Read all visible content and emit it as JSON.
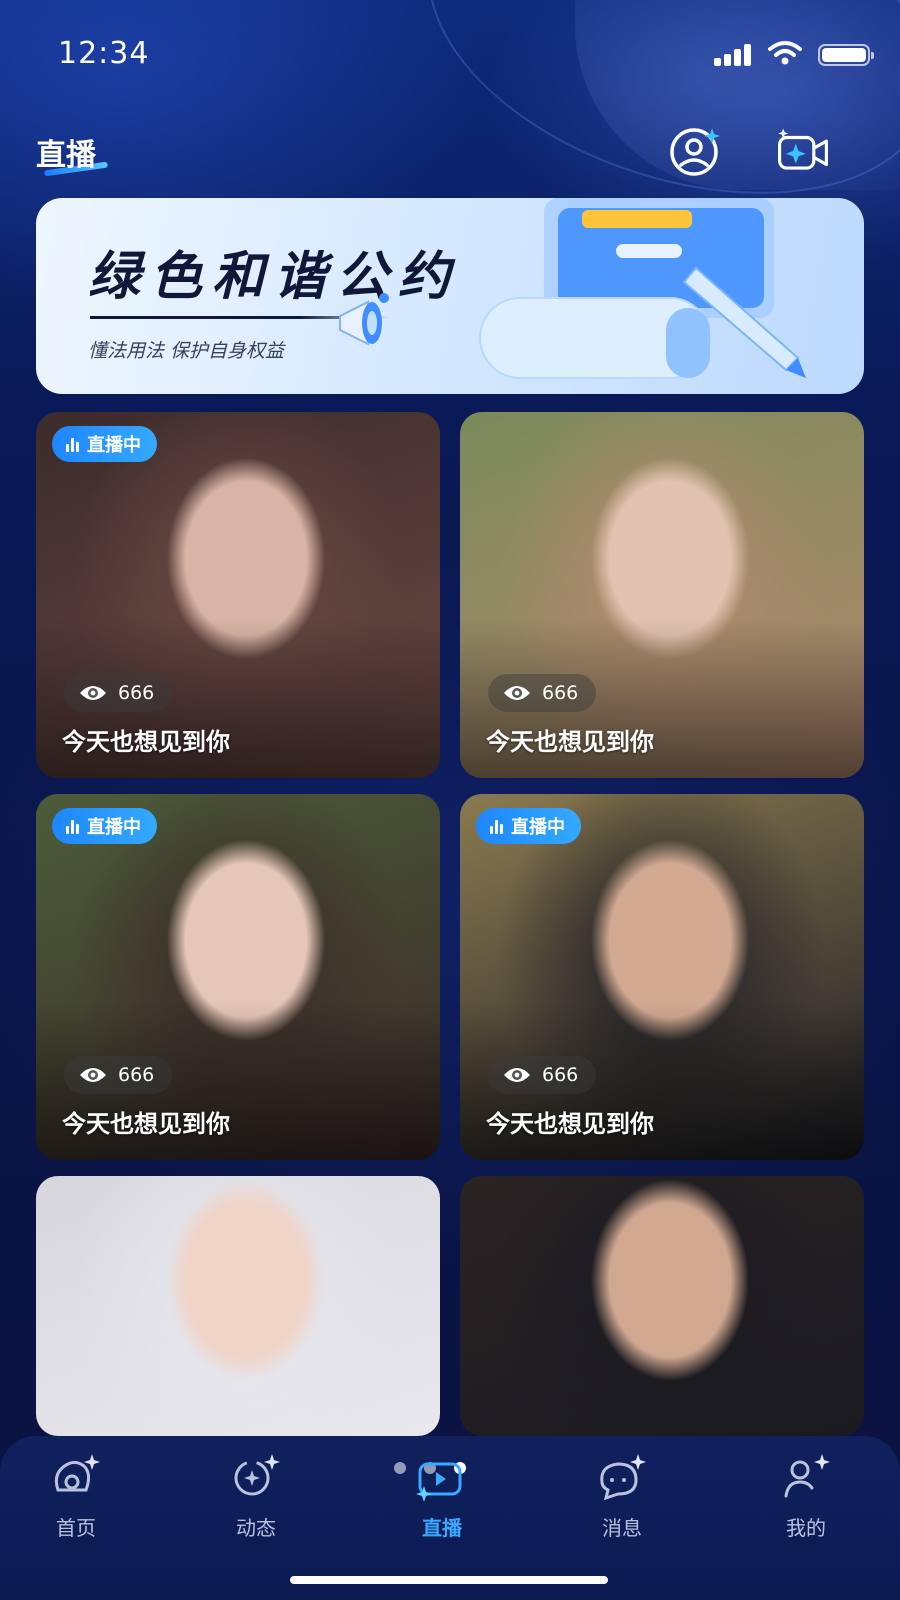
{
  "status_bar": {
    "time": "12:34"
  },
  "header": {
    "title": "直播"
  },
  "banner": {
    "title": "绿色和谐公约",
    "subtitle": "懂法用法 保护自身权益"
  },
  "streams": [
    {
      "live_label": "直播中",
      "viewers": "666",
      "title": "今天也想见到你",
      "is_live": true,
      "palette": [
        "#3b2b2a",
        "#d7b4a6",
        "#6b4a44"
      ]
    },
    {
      "live_label": "",
      "viewers": "666",
      "title": "今天也想见到你",
      "is_live": false,
      "palette": [
        "#7a8a5a",
        "#e2c2b0",
        "#b48a70"
      ]
    },
    {
      "live_label": "直播中",
      "viewers": "666",
      "title": "今天也想见到你",
      "is_live": true,
      "palette": [
        "#4c5c3a",
        "#e6c6b8",
        "#3a2a28"
      ]
    },
    {
      "live_label": "直播中",
      "viewers": "666",
      "title": "今天也想见到你",
      "is_live": true,
      "palette": [
        "#8a7a50",
        "#d2aa92",
        "#1c1c24"
      ]
    },
    {
      "live_label": "",
      "viewers": "",
      "title": "",
      "is_live": false,
      "palette": [
        "#d6d6dc",
        "#f0d4c8",
        "#e8e8ee"
      ]
    },
    {
      "live_label": "",
      "viewers": "",
      "title": "",
      "is_live": false,
      "palette": [
        "#2a2424",
        "#d0a890",
        "#1a1a20"
      ]
    }
  ],
  "nav": {
    "items": [
      {
        "label": "首页",
        "icon": "home-icon"
      },
      {
        "label": "动态",
        "icon": "moments-icon"
      },
      {
        "label": "直播",
        "icon": "live-icon",
        "active": true
      },
      {
        "label": "消息",
        "icon": "message-icon"
      },
      {
        "label": "我的",
        "icon": "profile-icon"
      }
    ]
  },
  "colors": {
    "accent": "#2f9bff",
    "background": "#0a1448",
    "nav_active": "#3aa8ff"
  }
}
